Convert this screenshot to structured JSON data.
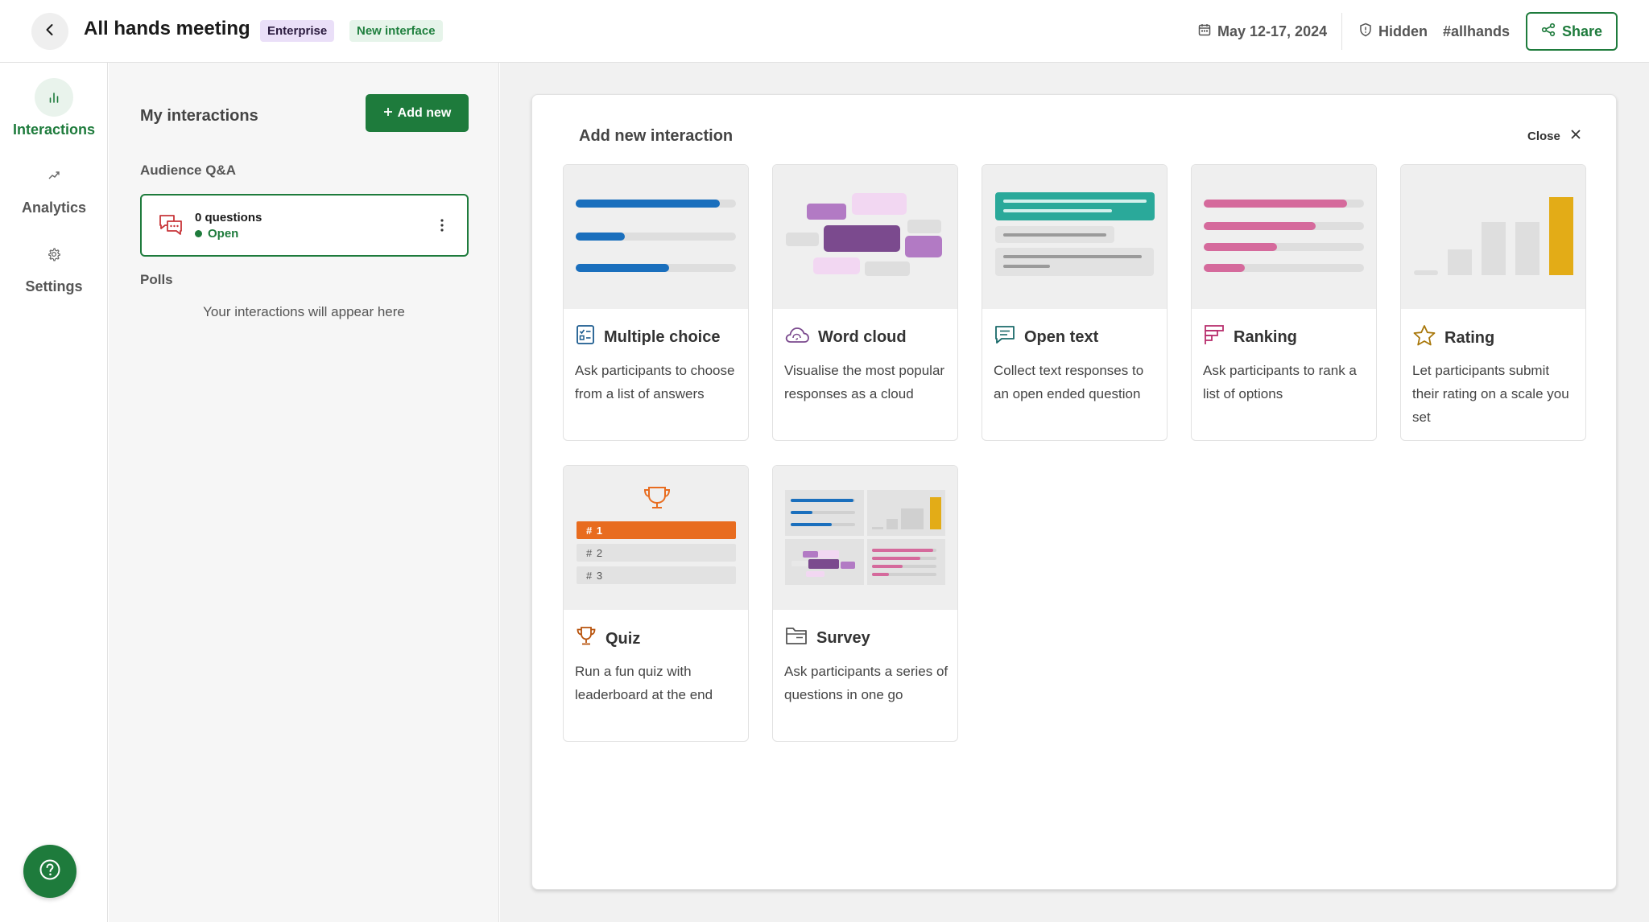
{
  "header": {
    "back_icon": "chevron-left-icon",
    "title": "All hands meeting",
    "badge_enterprise": "Enterprise",
    "badge_new_interface": "New interface",
    "date_range": "May 12-17, 2024",
    "visibility": "Hidden",
    "hashtag": "#allhands",
    "share_label": "Share"
  },
  "nav": {
    "items": [
      {
        "label": "Interactions",
        "icon": "bar-chart-icon",
        "active": true
      },
      {
        "label": "Analytics",
        "icon": "trend-up-icon",
        "active": false
      },
      {
        "label": "Settings",
        "icon": "gear-icon",
        "active": false
      }
    ],
    "help_icon": "question-circle-icon"
  },
  "interactions_panel": {
    "title": "My interactions",
    "add_new_label": "Add new",
    "audience_qa_label": "Audience Q&A",
    "qa_card": {
      "count": "0 questions",
      "status": "Open"
    },
    "polls_label": "Polls",
    "empty_message": "Your interactions will appear here"
  },
  "modal": {
    "title": "Add new interaction",
    "close_label": "Close",
    "cards": [
      {
        "title": "Multiple choice",
        "description": "Ask participants to choose from a list of answers",
        "icon": "checklist-icon"
      },
      {
        "title": "Word cloud",
        "description": "Visualise the most popular responses as a cloud",
        "icon": "cloud-icon"
      },
      {
        "title": "Open text",
        "description": "Collect text responses to an open ended question",
        "icon": "speech-bubble-icon"
      },
      {
        "title": "Ranking",
        "description": "Ask participants to rank a list of options",
        "icon": "ranking-icon"
      },
      {
        "title": "Rating",
        "description": "Let participants submit their rating on a scale you set",
        "icon": "star-icon"
      },
      {
        "title": "Quiz",
        "description": "Run a fun quiz with leaderboard at the end",
        "icon": "trophy-icon"
      },
      {
        "title": "Survey",
        "description": "Ask participants a series of questions in one go",
        "icon": "folder-icon"
      }
    ],
    "quiz_ranks": [
      "# 1",
      "# 2",
      "# 3"
    ]
  },
  "colors": {
    "brand_green": "#1e7b3c",
    "blue": "#1a6fbd",
    "purple": "#7b4a8e",
    "teal": "#2aa99a",
    "pink": "#d56a9c",
    "gold": "#e3ac17",
    "orange": "#e86c1f"
  }
}
